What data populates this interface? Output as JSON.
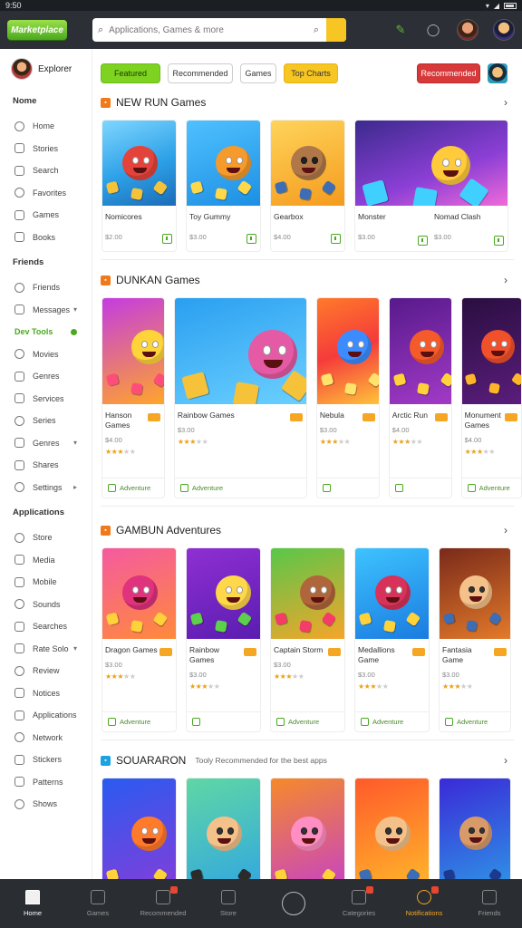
{
  "status_bar": {
    "time": "9:50",
    "icons": [
      "▾",
      "◢"
    ]
  },
  "header": {
    "logo_text": "Marketplace",
    "search_placeholder": "Applications, Games & more",
    "icons": [
      "chat-icon",
      "bell-icon",
      "profile-avatar",
      "alt-avatar"
    ]
  },
  "sidebar": {
    "profile_name": "Explorer",
    "groups": [
      {
        "heading": "Nome",
        "items": [
          {
            "label": "Home",
            "icon": "home-icon"
          },
          {
            "label": "Stories",
            "icon": "book-icon"
          },
          {
            "label": "Search",
            "icon": "search-icon"
          },
          {
            "label": "Favorites",
            "icon": "heart-icon"
          },
          {
            "label": "Games",
            "icon": "gamepad-icon"
          },
          {
            "label": "Books",
            "icon": "book-icon"
          }
        ]
      },
      {
        "heading": "Friends",
        "items": [
          {
            "label": "Friends",
            "icon": "search-icon"
          },
          {
            "label": "Messages",
            "icon": "inbox-icon",
            "chevron": "▾"
          },
          {
            "label": "Dev Tools",
            "active": true
          },
          {
            "label": "Movies",
            "icon": "film-icon"
          },
          {
            "label": "Genres",
            "icon": "grid-icon"
          },
          {
            "label": "Services",
            "icon": "tv-icon"
          },
          {
            "label": "Series",
            "icon": "list-icon"
          },
          {
            "label": "Genres",
            "icon": "folder-icon",
            "chevron": "▾"
          },
          {
            "label": "Shares",
            "icon": "share-icon"
          },
          {
            "label": "Settings",
            "icon": "gear-icon",
            "chevron": "▸"
          }
        ]
      },
      {
        "heading": "Applications",
        "items": [
          {
            "label": "Store",
            "icon": "bag-icon"
          },
          {
            "label": "Media",
            "icon": "image-icon"
          },
          {
            "label": "Mobile",
            "icon": "phone-icon"
          },
          {
            "label": "Sounds",
            "icon": "sound-icon"
          },
          {
            "label": "Searches",
            "icon": "search-icon"
          },
          {
            "label": "Rate Solo",
            "icon": "star-icon",
            "chevron": "▾"
          },
          {
            "label": "Review",
            "icon": "review-icon"
          },
          {
            "label": "Notices",
            "icon": "bell-icon"
          },
          {
            "label": "Applications",
            "icon": "app-icon"
          },
          {
            "label": "Network",
            "icon": "globe-icon"
          },
          {
            "label": "Stickers",
            "icon": "sticker-icon"
          },
          {
            "label": "Patterns",
            "icon": "pattern-icon"
          },
          {
            "label": "Shows",
            "icon": "tv-icon"
          }
        ]
      }
    ]
  },
  "chips": {
    "items": [
      "Featured",
      "Recommended",
      "Games",
      "Top Charts"
    ],
    "cta": "Recommended"
  },
  "sections": [
    {
      "title": "NEW RUN Games",
      "subtitle": "",
      "cards": [
        {
          "title": "Nomicores",
          "sub": "",
          "price": "$2.00",
          "art": "red-monster"
        },
        {
          "title": "Toy Gummy",
          "sub": "",
          "price": "$3.00",
          "art": "orange-bear"
        },
        {
          "title": "Gearbox",
          "sub": "",
          "price": "$4.00",
          "art": "machine"
        },
        {
          "title": "Monster",
          "sub": "",
          "price": "$3.00",
          "art": "mercia"
        },
        {
          "title": "Nomad Clash",
          "sub": "",
          "price": "$3.00",
          "art": "mercia-right"
        }
      ]
    },
    {
      "title": "DUNKAN Games",
      "subtitle": "",
      "cards": [
        {
          "title": "Hanson",
          "sub": "Games",
          "price": "$4.00",
          "stars": 3,
          "footer": "Adventure",
          "art": "yellow-monster"
        },
        {
          "title": "Rainbow Games",
          "sub": "",
          "price": "$3.00",
          "stars": 3,
          "footer": "Adventure",
          "art": "matchers"
        },
        {
          "title": "Nebula",
          "sub": "",
          "price": "$3.00",
          "stars": 3,
          "footer": "",
          "art": "robot"
        },
        {
          "title": "Arctic Run",
          "sub": "",
          "price": "$4.00",
          "stars": 3,
          "footer": "",
          "art": "robot2"
        },
        {
          "title": "Monument Games",
          "sub": "",
          "price": "$4.00",
          "stars": 3,
          "footer": "Adventure",
          "art": "red-creature"
        }
      ]
    },
    {
      "title": "GAMBUN Adventures",
      "subtitle": "",
      "cards": [
        {
          "title": "Dragon Games",
          "sub": "",
          "price": "$3.00",
          "stars": 3,
          "footer": "Adventure",
          "art": "pink-bear"
        },
        {
          "title": "Rainbow Games",
          "sub": "",
          "price": "$3.00",
          "stars": 3,
          "footer": "",
          "art": "amazon"
        },
        {
          "title": "Captain Storm",
          "sub": "",
          "price": "$3.00",
          "stars": 3,
          "footer": "Adventure",
          "art": "wonders"
        },
        {
          "title": "Medallions Game",
          "sub": "",
          "price": "$3.00",
          "stars": 3,
          "footer": "Adventure",
          "art": "blocks"
        },
        {
          "title": "Fantasia Game",
          "sub": "",
          "price": "$3.00",
          "stars": 3,
          "footer": "Adventure",
          "art": "girl"
        }
      ]
    },
    {
      "title": "SOUARARON",
      "subtitle": "Tooly Recommended for the best apps",
      "cards": [
        {
          "title": "",
          "art": "treasure"
        },
        {
          "title": "",
          "art": "boy"
        },
        {
          "title": "",
          "art": "pink-girl"
        },
        {
          "title": "",
          "art": "beanie"
        },
        {
          "title": "",
          "art": "fighter"
        }
      ]
    }
  ],
  "bottom_nav": [
    {
      "label": "Home",
      "icon": "home-icon",
      "state": "home"
    },
    {
      "label": "Games",
      "icon": "chat-icon"
    },
    {
      "label": "Recommended",
      "icon": "grid-icon",
      "badge": true
    },
    {
      "label": "Store",
      "icon": "bag-icon"
    },
    {
      "label": "",
      "icon": "center-icon"
    },
    {
      "label": "Categories",
      "icon": "category-icon",
      "badge": true
    },
    {
      "label": "Notifications",
      "icon": "bell-icon",
      "state": "active",
      "badge": true
    },
    {
      "label": "Friends",
      "icon": "people-icon"
    }
  ]
}
